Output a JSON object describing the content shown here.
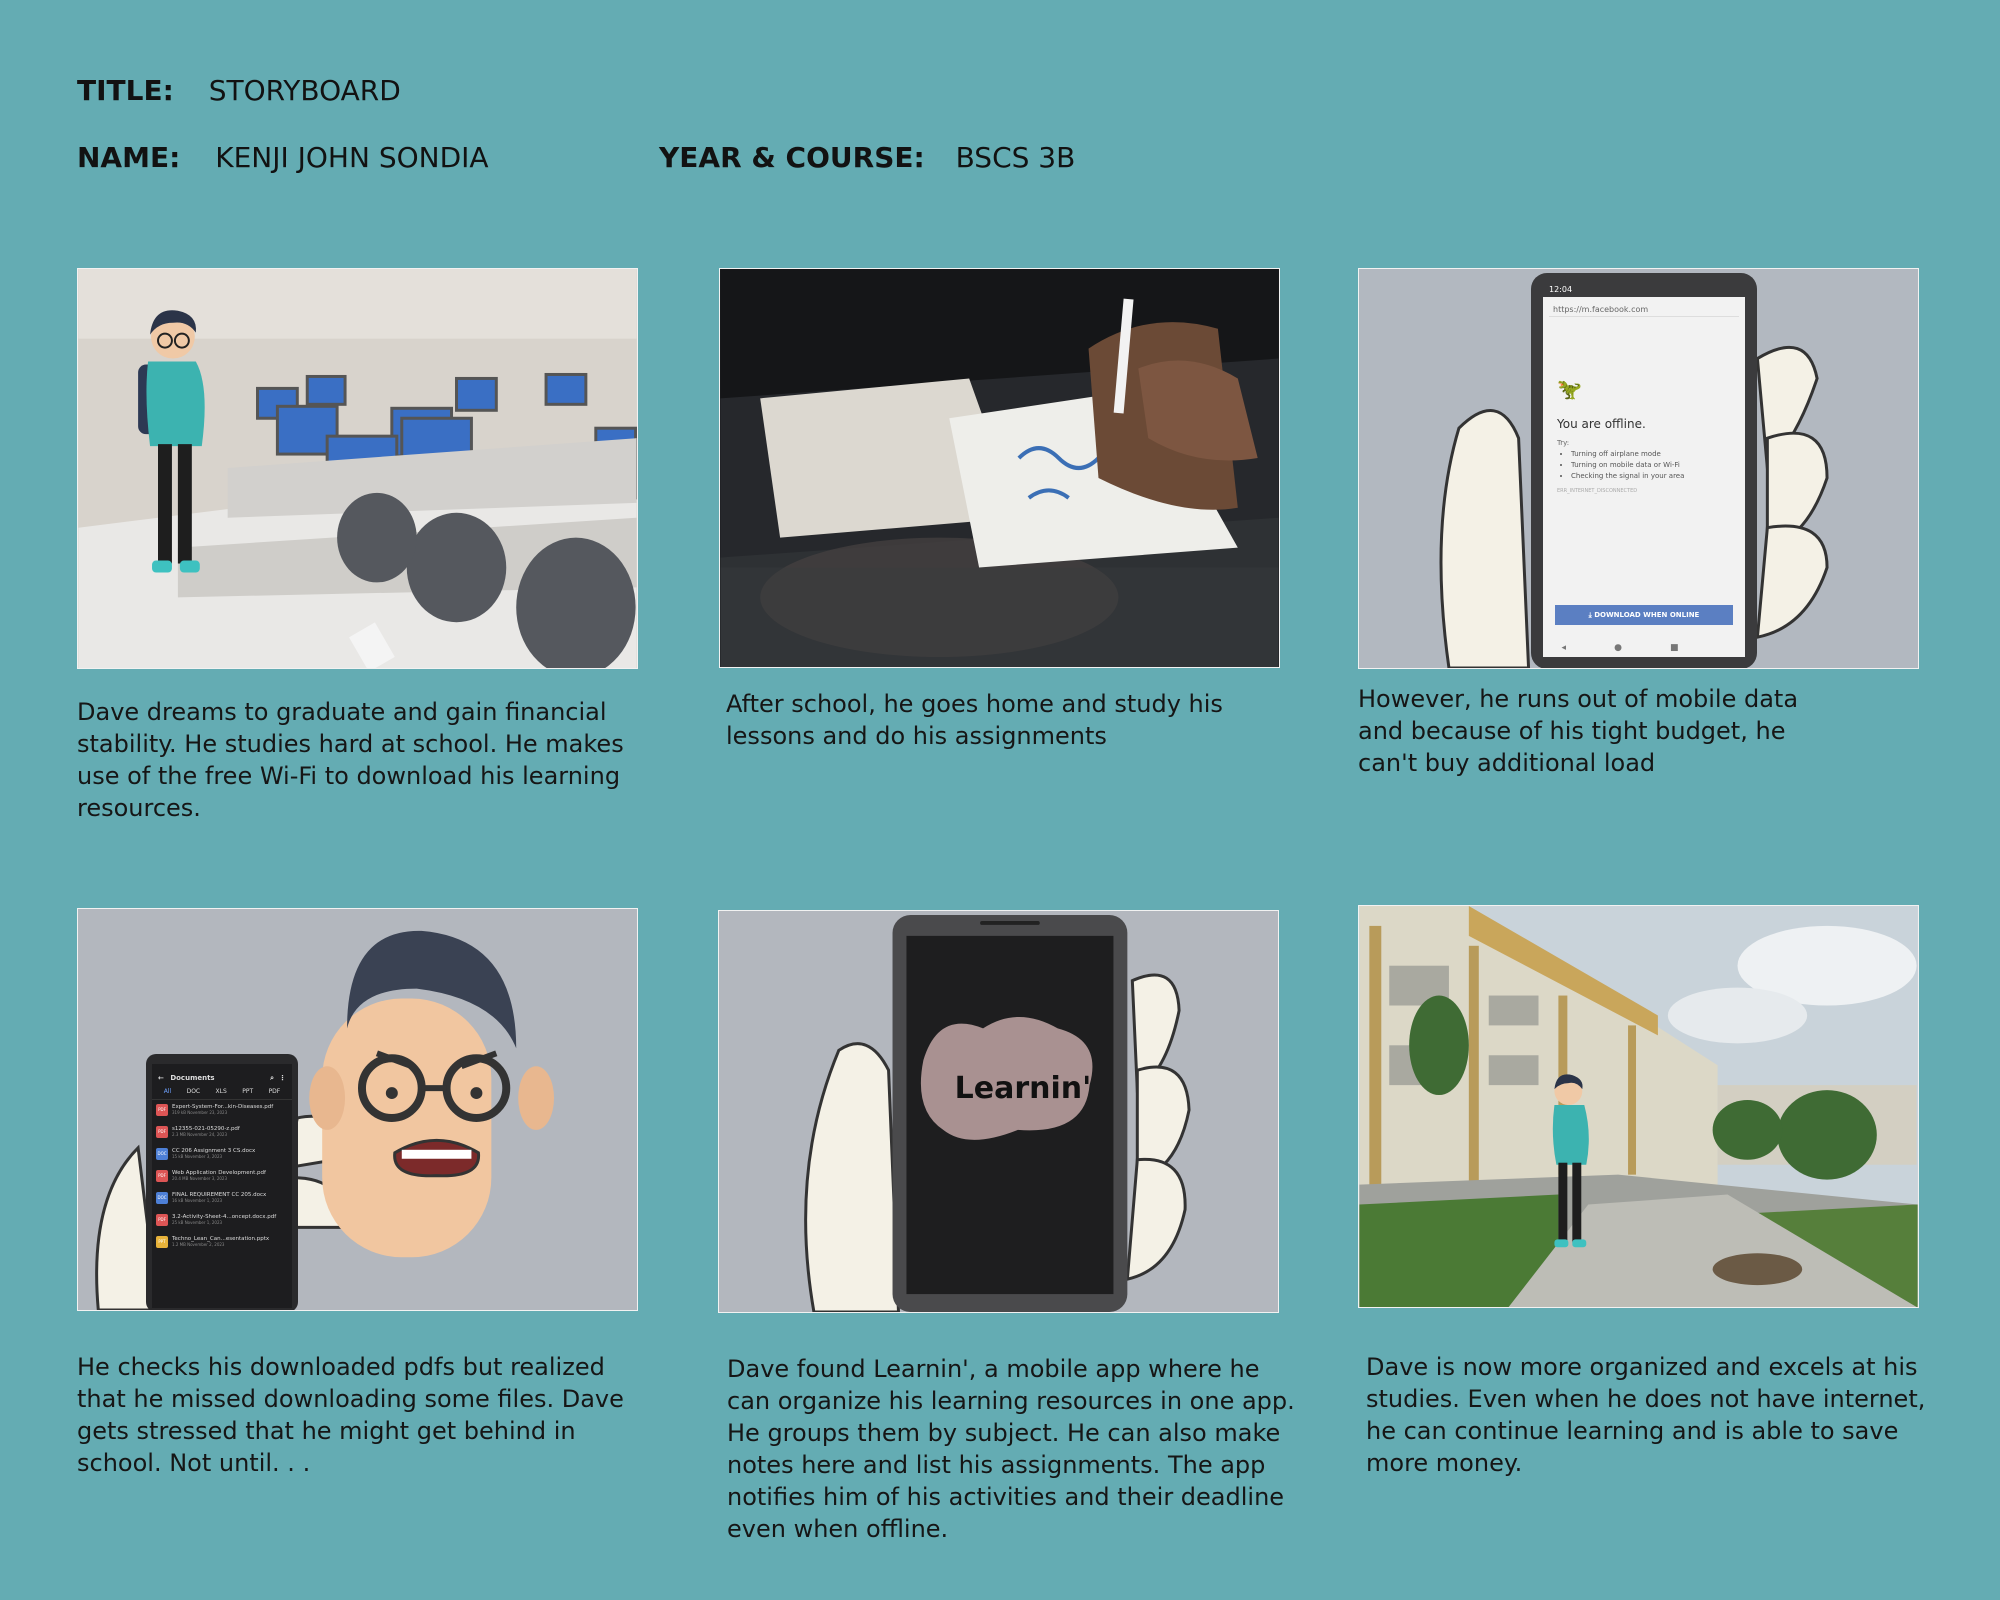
{
  "header": {
    "title_label": "TITLE:",
    "title_value": "STORYBOARD",
    "name_label": "NAME:",
    "name_value": "KENJI JOHN SONDIA",
    "course_label": "YEAR & COURSE:",
    "course_value": "BSCS 3B"
  },
  "panels": [
    {
      "caption": "Dave dreams to graduate and gain financial stability. He studies hard at school. He makes use of the free Wi-Fi to download his learning resources."
    },
    {
      "caption": "After school, he goes home and study his lessons and do his assignments"
    },
    {
      "caption": "However, he runs out of mobile data and because of his tight budget, he can't buy  additional load",
      "phone": {
        "time": "12:04",
        "url": "https://m.facebook.com",
        "offline_title": "You are offline.",
        "try_label": "Try:",
        "tips": [
          "Turning off airplane mode",
          "Turning on mobile data or Wi-Fi",
          "Checking the signal in your area"
        ],
        "error_code": "ERR_INTERNET_DISCONNECTED",
        "download_button": "DOWNLOAD WHEN ONLINE"
      }
    },
    {
      "caption": "He checks his downloaded pdfs but realized that he missed downloading some files. Dave gets stressed that he might get behind in school.  Not until. . .",
      "phone": {
        "title": "Documents",
        "tabs": [
          "All",
          "DOC",
          "XLS",
          "PPT",
          "PDF"
        ],
        "files": [
          {
            "type": "PDF",
            "name": "Expert-System-For...kin-Diseases.pdf",
            "meta": "319 kB  November 23, 2023"
          },
          {
            "type": "PDF",
            "name": "s12355-021-05290-z.pdf",
            "meta": "2.3 MB  November 24, 2023"
          },
          {
            "type": "DOC",
            "name": "CC 206 Assignment 3 CS.docx",
            "meta": "15 kB  November 3, 2023"
          },
          {
            "type": "PDF",
            "name": "Web Application Development.pdf",
            "meta": "20.4 MB  November 3, 2023"
          },
          {
            "type": "DOC",
            "name": "FINAL REQUIREMENT CC 205.docx",
            "meta": "16 kB  November 1, 2023"
          },
          {
            "type": "PDF",
            "name": "3.2-Activity-Sheet-4...oncept.docx.pdf",
            "meta": "25 kB  November 1, 2023"
          },
          {
            "type": "PPT",
            "name": "Techno_Lean_Can...esentation.pptx",
            "meta": "1.2 MB  November 2, 2023"
          }
        ]
      }
    },
    {
      "caption": "Dave found Learnin', a mobile app where he can organize his learning resources in one app. He groups them by subject. He can also make notes here and list his assignments. The app notifies him of his activities and their deadline even when offline.",
      "app_logo_text": "Learnin'"
    },
    {
      "caption": "Dave is now more organized and excels at his studies. Even when he does not have internet, he can continue learning and is able to save more money."
    }
  ]
}
